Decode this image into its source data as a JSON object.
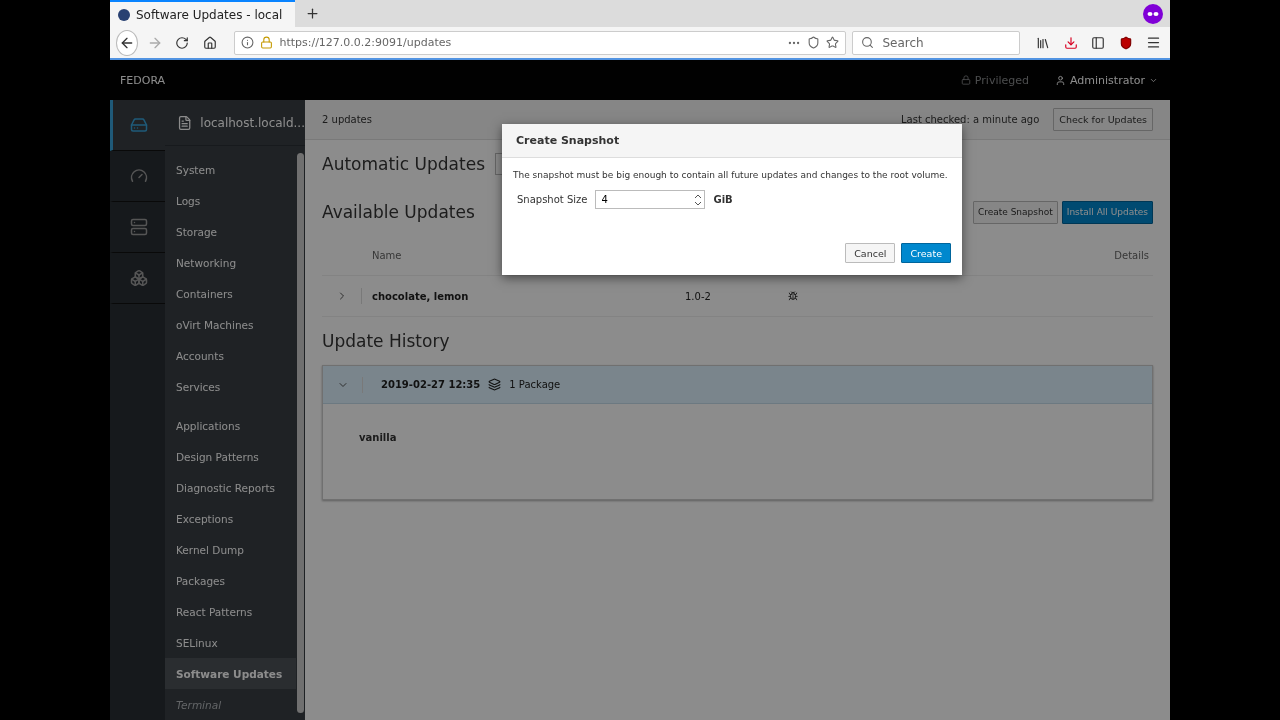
{
  "browser": {
    "tab_title": "Software Updates - local",
    "url": "https://127.0.0.2:9091/updates",
    "search": {
      "placeholder": "Search"
    }
  },
  "header": {
    "brand": "FEDORA",
    "privileged": "Privileged",
    "user": "Administrator"
  },
  "rail": [
    {
      "kind": "host",
      "selected": true
    },
    {
      "kind": "dashboard",
      "selected": false
    },
    {
      "kind": "servers",
      "selected": false
    },
    {
      "kind": "clusters",
      "selected": false
    }
  ],
  "host": "localhost.locald...",
  "menu_groups": [
    {
      "items": [
        {
          "label": "System",
          "selected": false,
          "dimmed": false
        },
        {
          "label": "Logs",
          "selected": false,
          "dimmed": false
        },
        {
          "label": "Storage",
          "selected": false,
          "dimmed": false
        },
        {
          "label": "Networking",
          "selected": false,
          "dimmed": false
        },
        {
          "label": "Containers",
          "selected": false,
          "dimmed": false
        },
        {
          "label": "oVirt Machines",
          "selected": false,
          "dimmed": false
        },
        {
          "label": "Accounts",
          "selected": false,
          "dimmed": false
        },
        {
          "label": "Services",
          "selected": false,
          "dimmed": false
        }
      ]
    },
    {
      "items": [
        {
          "label": "Applications",
          "selected": false,
          "dimmed": false
        },
        {
          "label": "Design Patterns",
          "selected": false,
          "dimmed": false
        },
        {
          "label": "Diagnostic Reports",
          "selected": false,
          "dimmed": false
        },
        {
          "label": "Exceptions",
          "selected": false,
          "dimmed": false
        },
        {
          "label": "Kernel Dump",
          "selected": false,
          "dimmed": false
        },
        {
          "label": "Packages",
          "selected": false,
          "dimmed": false
        },
        {
          "label": "React Patterns",
          "selected": false,
          "dimmed": false
        },
        {
          "label": "SELinux",
          "selected": false,
          "dimmed": false
        },
        {
          "label": "Software Updates",
          "selected": true,
          "dimmed": false
        },
        {
          "label": "Terminal",
          "selected": false,
          "dimmed": true
        }
      ]
    }
  ],
  "content": {
    "count": "2 updates",
    "last_checked": "Last checked: a minute ago",
    "check_button": "Check for Updates",
    "automatic_heading": "Automatic Updates",
    "available_heading": "Available Updates",
    "snapshot_button": "Create Snapshot",
    "install_button": "Install All Updates",
    "columns": [
      "Name",
      "Details"
    ],
    "rows": [
      {
        "name": "chocolate, lemon",
        "version": "1.0-2",
        "expanded": false
      }
    ],
    "history_heading": "Update History",
    "history": [
      {
        "date": "2019-02-27 12:35",
        "packages": "1 Package",
        "expanded": true,
        "items": [
          "vanilla"
        ]
      }
    ]
  },
  "dialog": {
    "title": "Create Snapshot",
    "message": "The snapshot must be big enough to contain all future updates and changes to the root volume.",
    "field": {
      "label": "Snapshot Size",
      "value": "4",
      "unit": "GiB"
    },
    "buttons": [
      {
        "label": "Cancel",
        "kind": "default"
      },
      {
        "label": "Create",
        "kind": "primary"
      }
    ]
  }
}
